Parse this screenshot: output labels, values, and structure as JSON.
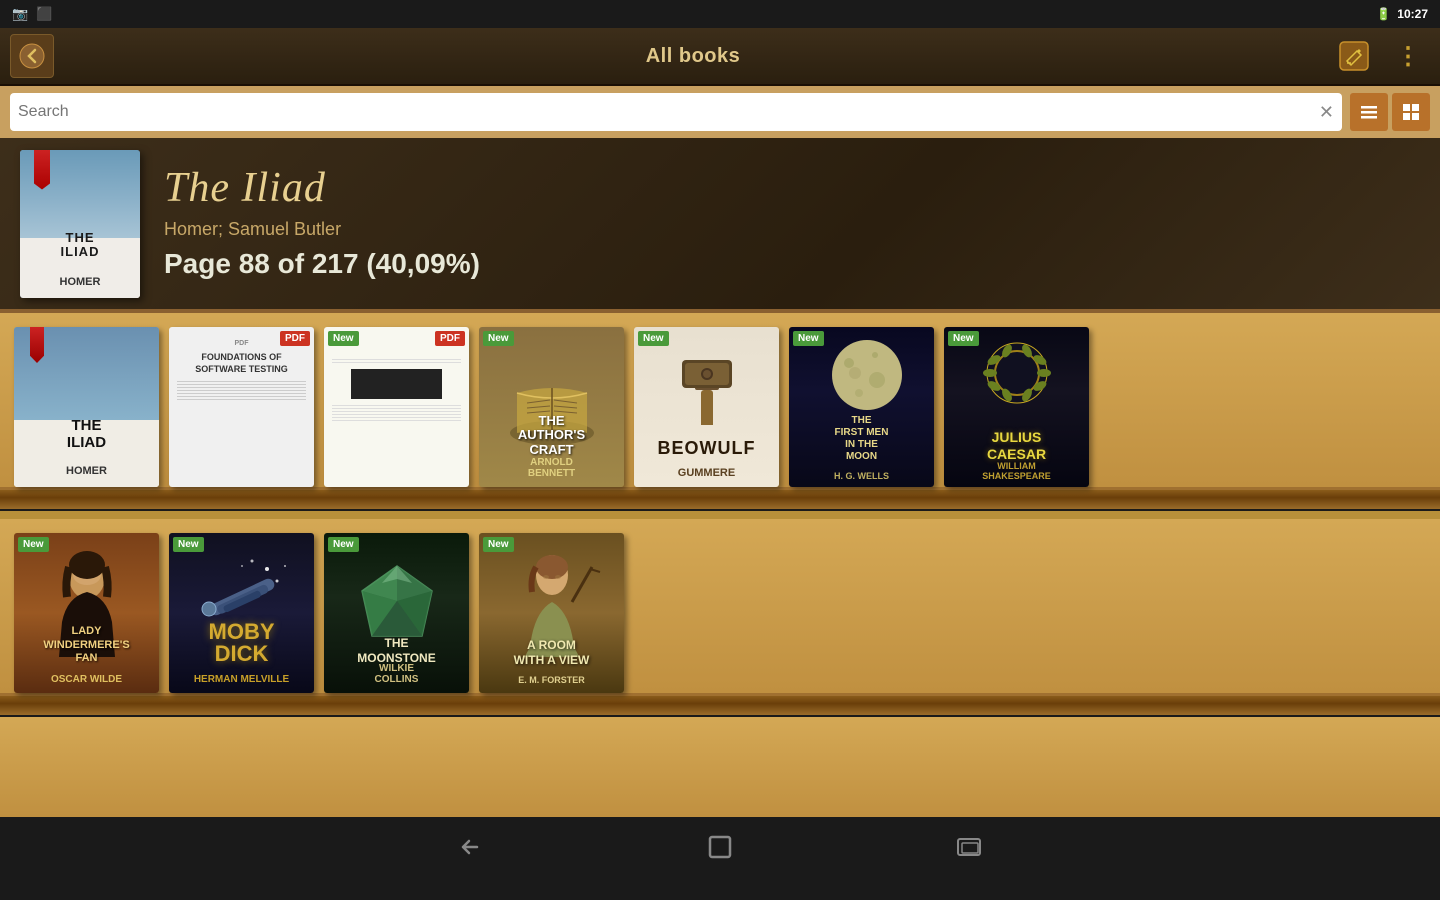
{
  "statusBar": {
    "time": "10:27",
    "batteryIcon": "🔋",
    "leftIcons": [
      "📷",
      "⬛"
    ]
  },
  "topBar": {
    "title": "All books",
    "backLabel": "←",
    "editIcon": "✏",
    "menuIcon": "⋮"
  },
  "searchBar": {
    "placeholder": "Search",
    "clearIcon": "✕",
    "listViewIcon": "≡",
    "gridViewIcon": "⊞"
  },
  "currentBook": {
    "title": "The Iliad",
    "author": "Homer; Samuel Butler",
    "progress": "Page 88 of 217 (40,09%)"
  },
  "shelf1": {
    "books": [
      {
        "id": "iliad",
        "title": "THE\nILIAD",
        "author": "HOMER",
        "badge": null,
        "pdfBadge": null,
        "style": "iliad"
      },
      {
        "id": "foundations",
        "title": "FOUNDATIONS OF SOFTWARE TESTING",
        "author": "",
        "badge": null,
        "pdfBadge": "PDF",
        "style": "foundations"
      },
      {
        "id": "testing",
        "title": "",
        "author": "",
        "badge": "New",
        "pdfBadge": "PDF",
        "style": "testing"
      },
      {
        "id": "authors-craft",
        "title": "THE\nAUTHOR'S\nCRAFT",
        "author": "ARNOLD\nBENNETT",
        "badge": "New",
        "pdfBadge": null,
        "style": "authors-craft"
      },
      {
        "id": "beowulf",
        "title": "BEOWULF",
        "author": "GUMMERE",
        "badge": "New",
        "pdfBadge": null,
        "style": "beowulf"
      },
      {
        "id": "first-men",
        "title": "THE\nFIRST MEN\nIN THE\nMOON",
        "author": "H. G. WELLS",
        "badge": "New",
        "pdfBadge": null,
        "style": "first-men"
      },
      {
        "id": "julius",
        "title": "JULIUS\nCAESAR",
        "author": "WILLIAM\nSHAKESPEARE",
        "badge": "New",
        "pdfBadge": null,
        "style": "julius"
      }
    ]
  },
  "shelf2": {
    "books": [
      {
        "id": "lady",
        "title": "LADY\nWINDERMERE'S\nFAN",
        "author": "OSCAR WILDE",
        "badge": "New",
        "pdfBadge": null,
        "style": "lady"
      },
      {
        "id": "moby",
        "title": "MOBY\nDICK",
        "author": "HERMAN MELVILLE",
        "badge": "New",
        "pdfBadge": null,
        "style": "moby"
      },
      {
        "id": "moonstone",
        "title": "THE\nMOONSTONE",
        "author": "WILKIE\nCOLLINS",
        "badge": "New",
        "pdfBadge": null,
        "style": "moonstone"
      },
      {
        "id": "room",
        "title": "A ROOM\nWITH\nA VIEW",
        "author": "E. M. FORSTER",
        "badge": "New",
        "pdfBadge": null,
        "style": "room"
      }
    ]
  },
  "navBar": {
    "backIcon": "←",
    "homeIcon": "⬜",
    "recentIcon": "▭"
  }
}
